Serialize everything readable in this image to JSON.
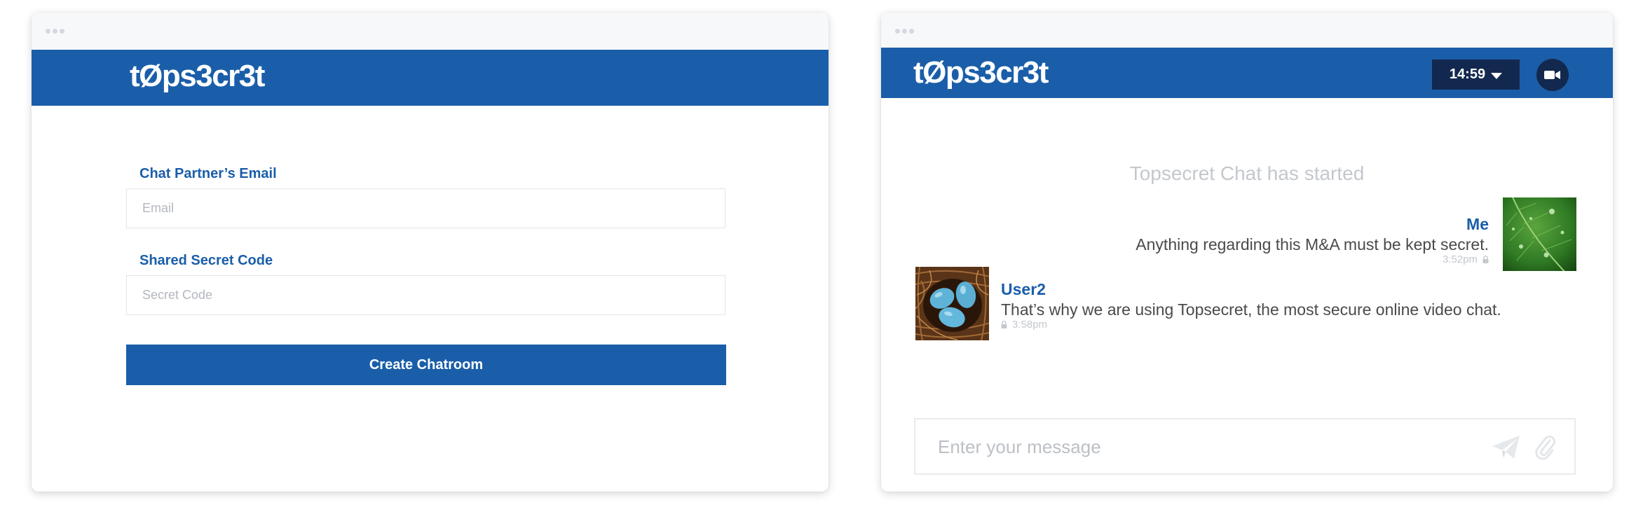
{
  "brand": {
    "logo_text": "tØps3cr3t",
    "color": "#1a5ea9",
    "dark_color": "#13284e"
  },
  "create_form": {
    "email": {
      "label": "Chat Partner’s Email",
      "placeholder": "Email",
      "value": ""
    },
    "secret": {
      "label": "Shared Secret Code",
      "placeholder": "Secret Code",
      "value": ""
    },
    "submit_label": "Create Chatroom"
  },
  "chat": {
    "timer": {
      "label": "14:59",
      "icon": "caret-down-icon"
    },
    "video_button_icon": "video-camera-icon",
    "system_message": "Topsecret Chat has started",
    "messages": [
      {
        "sender": "Me",
        "text": "Anything regarding this M&A must be kept secret.",
        "time": "3:52pm",
        "status_icon": "lock-icon",
        "avatar": "green-leaf-photo"
      },
      {
        "sender": "User2",
        "text": "That’s why we are using Topsecret, the most secure online video chat.",
        "time": "3:58pm",
        "status_icon": "lock-icon",
        "avatar": "blue-eggs-in-nest-photo"
      }
    ],
    "composer": {
      "placeholder": "Enter your message",
      "value": "",
      "send_icon": "paper-plane-icon",
      "attach_icon": "paperclip-icon"
    }
  }
}
